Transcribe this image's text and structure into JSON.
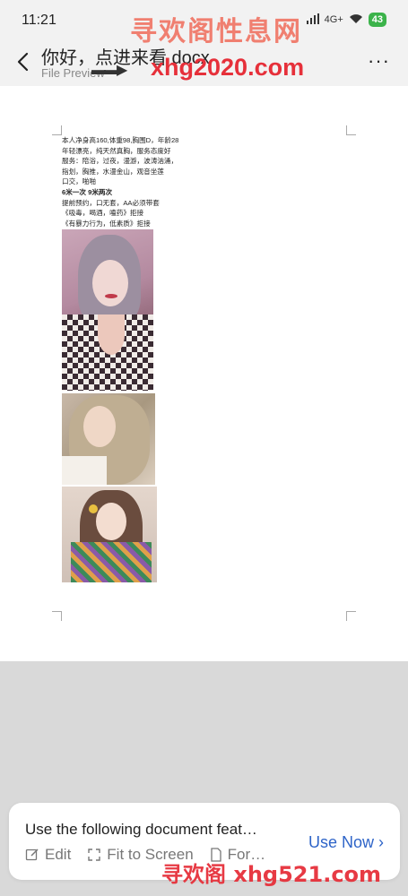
{
  "status_bar": {
    "time": "11:21",
    "network": "4G+",
    "battery": "43",
    "icons": [
      "signal-icon",
      "wifi-icon",
      "battery-icon"
    ]
  },
  "header": {
    "title": "你好，点进来看 docx",
    "subtitle": "File Preview",
    "more_icon": "more-icon",
    "back_icon": "back-icon"
  },
  "watermarks": {
    "top_text": "寻欢阁性息网",
    "top_url": "xhg2020.com",
    "bottom_text": "寻欢阁 xhg521.com"
  },
  "document": {
    "lines": [
      "本人净身高160,体重98,胸围D，年龄28",
      "年轻漂亮，纯天然真胸，服务态度好",
      "服务：陪浴，过夜，漫游，波涛汹涌，",
      "指划，胸推，水漫金山，观音坐莲",
      "口交，啪啪",
      "6米一次  9米两次",
      "提前预约，口无套，AA必须带套",
      "《吸毒，喝酒，嗑药》拒接",
      "《有暴力行为，低素质》拒接"
    ],
    "photos": [
      "photo-1",
      "photo-2",
      "photo-3"
    ]
  },
  "banner": {
    "title": "Use the following document feat…",
    "features": [
      {
        "icon": "edit-icon",
        "label": "Edit"
      },
      {
        "icon": "fit-screen-icon",
        "label": "Fit to Screen"
      },
      {
        "icon": "format-icon",
        "label": "For…"
      }
    ],
    "action_label": "Use Now ›",
    "action_color": "#2e64c8"
  }
}
